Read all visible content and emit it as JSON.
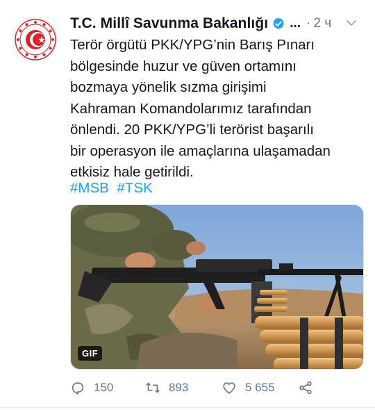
{
  "author": {
    "display_name": "T.C. Millî Savunma Bakanlığı",
    "ellipsis": "...",
    "separator": "·",
    "timestamp": "2 ч"
  },
  "tweet": {
    "text": "Terör örgütü PKK/YPG’nin Barış Pınarı\nbölgesinde huzur ve güven ortamını\nbozmaya yönelik sızma girişimi\nKahraman Komandolarımız tarafından\nönlendi. 20 PKK/YPG’li terörist başarılı\nbir operasyon ile amaçlarına ulaşamadan\netkisiz hale getirildi.",
    "hashtags": [
      "#MSB",
      "#TSK"
    ]
  },
  "media": {
    "badge": "GIF"
  },
  "actions": {
    "replies": "150",
    "retweets": "893",
    "likes": "5 655"
  },
  "colors": {
    "link": "#1da1f2",
    "muted": "#657786",
    "verified": "#1da1f2",
    "logo_red": "#d8232a"
  },
  "icons": {
    "verified": "verified-badge-icon",
    "menu": "chevron-down-icon",
    "reply": "reply-icon",
    "retweet": "retweet-icon",
    "like": "heart-icon",
    "share": "share-icon"
  }
}
